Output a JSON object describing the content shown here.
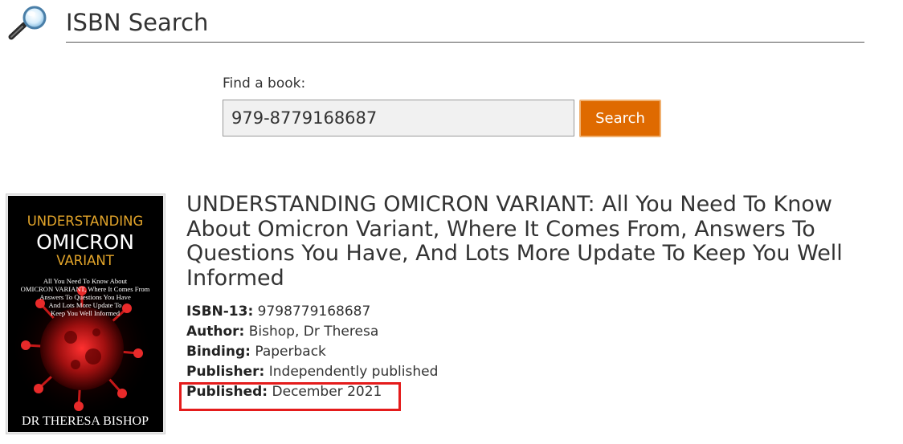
{
  "header": {
    "logo_icon": "magnifying-glass-icon",
    "title": "ISBN Search"
  },
  "search": {
    "label": "Find a book:",
    "value": "979-8779168687",
    "button_label": "Search",
    "button_color": "#df6a00"
  },
  "book": {
    "title": "UNDERSTANDING OMICRON VARIANT: All You Need To Know About Omicron Variant, Where It Comes From, Answers To Questions You Have, And Lots More Update To Keep You Well Informed",
    "cover": {
      "line1": "UNDERSTANDING",
      "line2": "OMICRON",
      "line3": "VARIANT",
      "blurb": [
        "All You Need To Know About",
        "OMICRON VARIANT, Where It Comes From",
        "Answers To Questions You Have",
        "And Lots More Update  To",
        "Keep You Well Informed"
      ],
      "author": "DR THERESA BISHOP"
    },
    "details": [
      {
        "label": "ISBN-13:",
        "value": "9798779168687"
      },
      {
        "label": "Author:",
        "value": "Bishop, Dr Theresa"
      },
      {
        "label": "Binding:",
        "value": "Paperback"
      },
      {
        "label": "Publisher:",
        "value": "Independently published"
      },
      {
        "label": "Published:",
        "value": "December 2021"
      }
    ],
    "highlight_color": "#e41b1b"
  }
}
